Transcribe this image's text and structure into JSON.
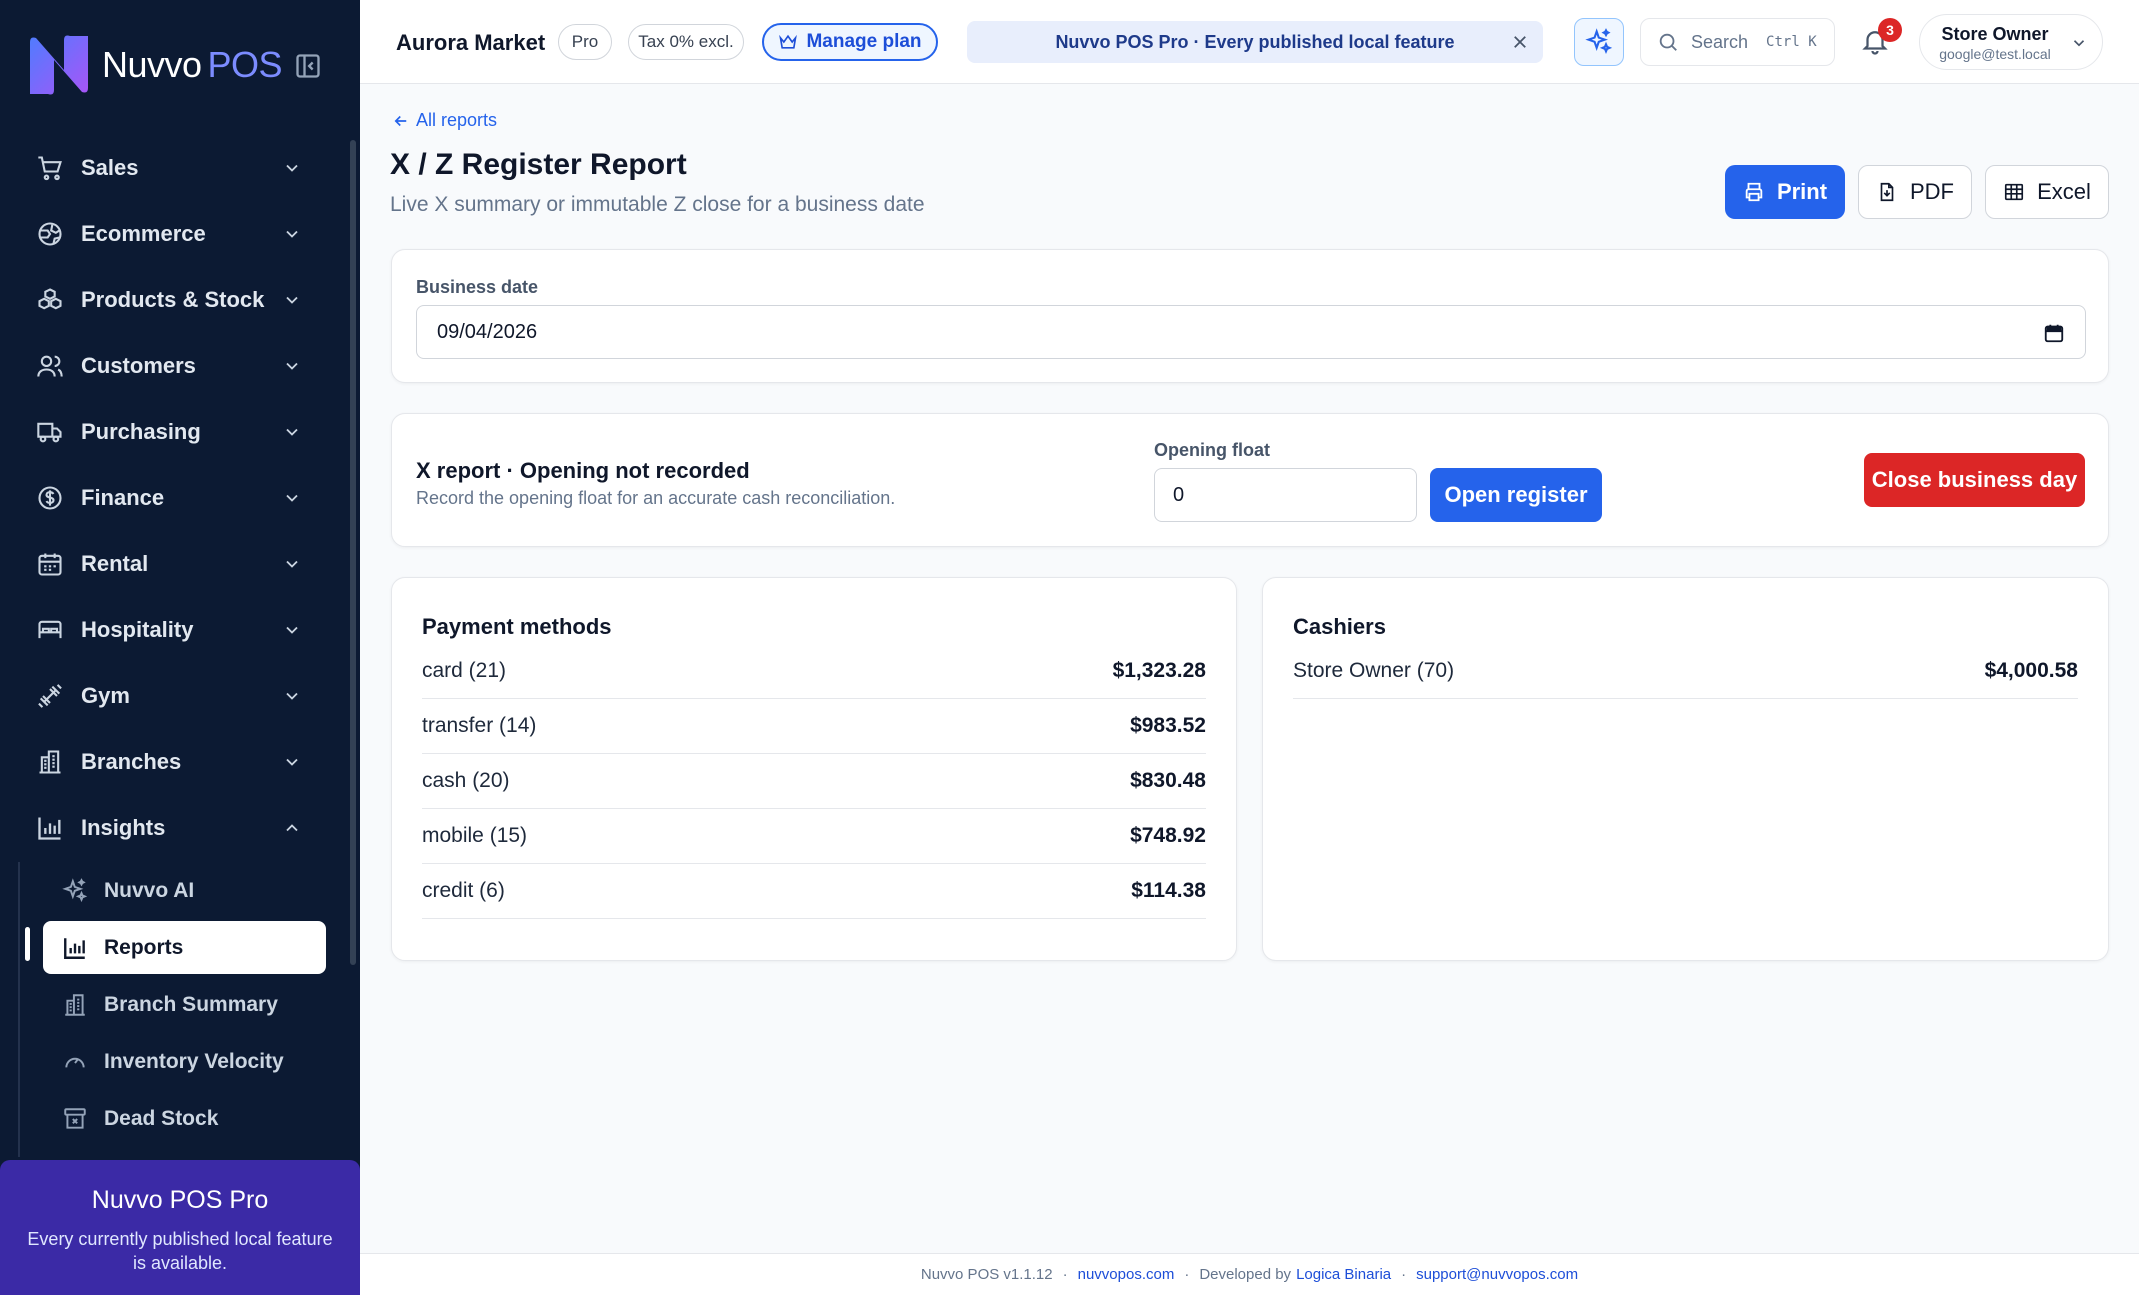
{
  "brand": {
    "name": "Nuvvo",
    "suffix": "POS"
  },
  "sidebar": {
    "items": [
      {
        "label": "Sales",
        "icon": "cart-icon"
      },
      {
        "label": "Ecommerce",
        "icon": "globe-icon"
      },
      {
        "label": "Products & Stock",
        "icon": "boxes-icon"
      },
      {
        "label": "Customers",
        "icon": "users-icon"
      },
      {
        "label": "Purchasing",
        "icon": "truck-icon"
      },
      {
        "label": "Finance",
        "icon": "dollar-circle-icon"
      },
      {
        "label": "Rental",
        "icon": "calendar-icon"
      },
      {
        "label": "Hospitality",
        "icon": "bed-icon"
      },
      {
        "label": "Gym",
        "icon": "dumbbell-icon"
      },
      {
        "label": "Branches",
        "icon": "building-icon"
      },
      {
        "label": "Insights",
        "icon": "bar-chart-icon"
      }
    ],
    "sub_items": [
      {
        "label": "Nuvvo AI",
        "icon": "sparkles-icon"
      },
      {
        "label": "Reports",
        "icon": "bar-chart-icon"
      },
      {
        "label": "Branch Summary",
        "icon": "building-icon"
      },
      {
        "label": "Inventory Velocity",
        "icon": "gauge-icon"
      },
      {
        "label": "Dead Stock",
        "icon": "archive-x-icon"
      }
    ],
    "promo": {
      "title": "Nuvvo POS Pro",
      "text": "Every currently published local feature is available."
    }
  },
  "header": {
    "store": "Aurora Market",
    "plan_badge": "Pro",
    "tax_badge": "Tax 0% excl.",
    "manage_plan": "Manage plan",
    "banner": "Nuvvo POS Pro · Every published local feature",
    "search_placeholder": "Search",
    "search_shortcut": "Ctrl K",
    "notifications": "3",
    "user_name": "Store Owner",
    "user_email": "google@test.local"
  },
  "page": {
    "back_link": "All reports",
    "title": "X / Z Register Report",
    "subtitle": "Live X summary or immutable Z close for a business date",
    "actions": {
      "print": "Print",
      "pdf": "PDF",
      "excel": "Excel"
    }
  },
  "business_date": {
    "label": "Business date",
    "value": "09/04/2026"
  },
  "x_report": {
    "title": "X report · Opening not recorded",
    "subtitle": "Record the opening float for an accurate cash reconciliation.",
    "float_label": "Opening float",
    "float_value": "0",
    "open_button": "Open register",
    "close_button": "Close business day"
  },
  "payment_methods": {
    "title": "Payment methods",
    "rows": [
      {
        "label": "card (21)",
        "amount": "$1,323.28"
      },
      {
        "label": "transfer (14)",
        "amount": "$983.52"
      },
      {
        "label": "cash (20)",
        "amount": "$830.48"
      },
      {
        "label": "mobile (15)",
        "amount": "$748.92"
      },
      {
        "label": "credit (6)",
        "amount": "$114.38"
      }
    ]
  },
  "cashiers": {
    "title": "Cashiers",
    "rows": [
      {
        "label": "Store Owner (70)",
        "amount": "$4,000.58"
      }
    ]
  },
  "footer": {
    "version": "Nuvvo POS v1.1.12",
    "site": "nuvvopos.com",
    "dev_prefix": "Developed by",
    "dev_name": "Logica Binaria",
    "support": "support@nuvvopos.com"
  },
  "colors": {
    "sidebar": "#0c1a33",
    "accent": "#2563eb",
    "danger": "#dc2626",
    "promo": "#3b2aa6"
  }
}
